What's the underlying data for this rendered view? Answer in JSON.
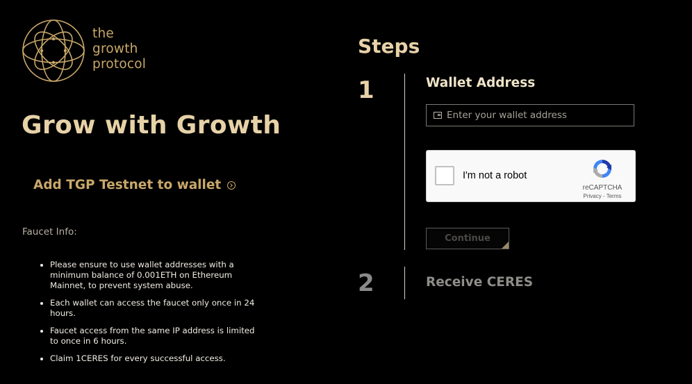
{
  "logo": {
    "lines": [
      "the",
      "growth",
      "protocol"
    ],
    "icon": "orbit-logo-icon",
    "color": "#c9a86a"
  },
  "headline": "Grow with Growth",
  "add_network": {
    "label": "Add TGP Testnet to wallet",
    "icon": "circle-arrow-right-icon"
  },
  "faucet": {
    "label": "Faucet Info:",
    "items": [
      "Please ensure to use wallet addresses with a minimum balance of 0.001ETH on Ethereum Mainnet, to prevent system abuse.",
      "Each wallet can access the faucet only once in 24 hours.",
      "Faucet access from the same IP address is limited to once in 6 hours.",
      "Claim 1CERES for every successful access."
    ]
  },
  "steps": {
    "title": "Steps",
    "step1": {
      "number": "1",
      "label": "Wallet Address",
      "input_placeholder": "Enter your wallet address",
      "input_value": "",
      "input_icon": "wallet-icon"
    },
    "recaptcha": {
      "checkbox_label": "I'm not a robot",
      "brand": "reCAPTCHA",
      "privacy": "Privacy",
      "separator": " - ",
      "terms": "Terms"
    },
    "continue_label": "Continue",
    "step2": {
      "number": "2",
      "label": "Receive CERES"
    }
  },
  "colors": {
    "background": "#000000",
    "gold": "#c9a86a",
    "headline": "#e7d2a8",
    "inactive": "#8f8d89"
  }
}
